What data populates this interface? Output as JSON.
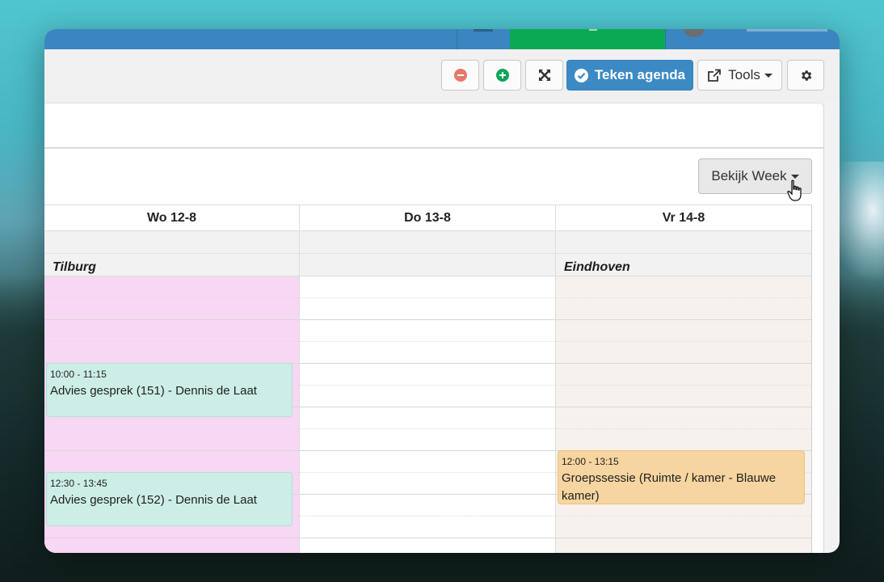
{
  "toolbar": {
    "teken_label": "Teken agenda",
    "tools_label": "Tools"
  },
  "view_button": {
    "label": "Bekijk Week"
  },
  "calendar": {
    "columns": [
      {
        "header": "Wo 12-8",
        "location": "Tilburg",
        "color": "#f7d7f4"
      },
      {
        "header": "Do 13-8",
        "location": "",
        "color": "#ffffff"
      },
      {
        "header": "Vr 14-8",
        "location": "Eindhoven",
        "color": "#f7f1ee"
      }
    ],
    "events": [
      {
        "time": "10:00 - 11:15",
        "title": "Advies gesprek (151) - Dennis de Laat",
        "color": "#cdeee7"
      },
      {
        "time": "12:30 - 13:45",
        "title": "Advies gesprek (152) - Dennis de Laat",
        "color": "#cdeee7"
      },
      {
        "time": "12:00 - 13:15",
        "title": "Groepssessie (Ruimte / kamer - Blauwe kamer)",
        "color": "#f6d5a0"
      }
    ]
  },
  "colors": {
    "topbar": "#3b86c0",
    "topbar_active": "#0aaa55",
    "primary_button": "#3b8ac4"
  },
  "icons": [
    "minus-circle-icon",
    "plus-circle-icon",
    "expand-icon",
    "check-circle-icon",
    "external-link-icon",
    "gear-icon",
    "pointer-cursor-icon"
  ]
}
